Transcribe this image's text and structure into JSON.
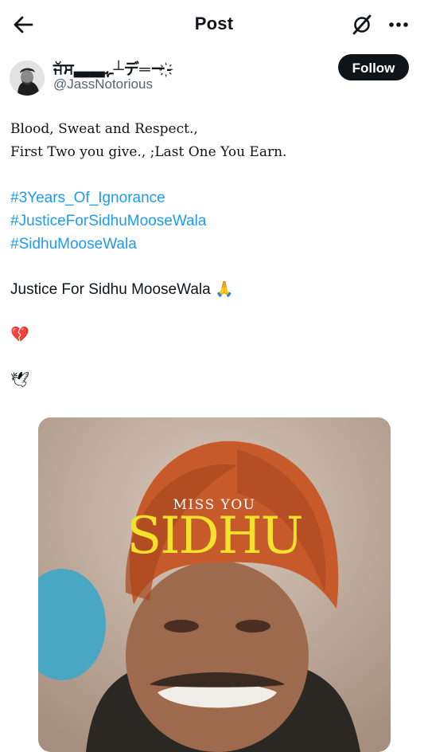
{
  "header": {
    "title": "Post",
    "back_icon": "arrow-left-icon",
    "grok_icon": "grok-icon",
    "more_icon": "more-horizontal-icon"
  },
  "author": {
    "display_name": "ਜੱਸ▃▃ـﮩ┴デ═ー҉-",
    "handle": "@JassNotorious",
    "follow_label": "Follow"
  },
  "post": {
    "line1": "Blood, Sweat and Respect.,",
    "line2": "First Two you give., ;Last One You Earn.",
    "hashtags": [
      "#3Years_Of_Ignorance",
      "#JusticeForSidhuMooseWala",
      "#SidhuMooseWala"
    ],
    "justice_line": "Justice For Sidhu MooseWala",
    "emoji_pray": "🙏",
    "emoji_broken_heart": "💔",
    "emoji_dove": "🕊"
  },
  "media": {
    "overlay_small": "MISS YOU",
    "overlay_big": "SIDHU"
  }
}
